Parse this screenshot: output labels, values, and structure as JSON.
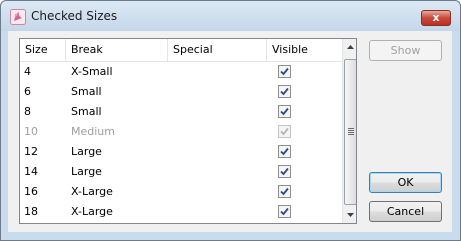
{
  "window": {
    "title": "Checked Sizes",
    "close_glyph": "x"
  },
  "table": {
    "columns": [
      "Size",
      "Break",
      "Special",
      "Visible"
    ],
    "rows": [
      {
        "size": "4",
        "break": "X-Small",
        "special": "",
        "visible": true,
        "enabled": true
      },
      {
        "size": "6",
        "break": "Small",
        "special": "",
        "visible": true,
        "enabled": true
      },
      {
        "size": "8",
        "break": "Small",
        "special": "",
        "visible": true,
        "enabled": true
      },
      {
        "size": "10",
        "break": "Medium",
        "special": "",
        "visible": true,
        "enabled": false
      },
      {
        "size": "12",
        "break": "Large",
        "special": "",
        "visible": true,
        "enabled": true
      },
      {
        "size": "14",
        "break": "Large",
        "special": "",
        "visible": true,
        "enabled": true
      },
      {
        "size": "16",
        "break": "X-Large",
        "special": "",
        "visible": true,
        "enabled": true
      },
      {
        "size": "18",
        "break": "X-Large",
        "special": "",
        "visible": true,
        "enabled": true
      }
    ]
  },
  "buttons": {
    "show": "Show",
    "ok": "OK",
    "cancel": "Cancel"
  },
  "icons": {
    "app": "app-icon",
    "close": "close-icon",
    "check": "check-icon"
  },
  "colors": {
    "titlebar": "#c4d7ea",
    "close": "#c9483a",
    "checkmark": "#2b4a8c",
    "disabled_text": "#a0a0a0"
  }
}
